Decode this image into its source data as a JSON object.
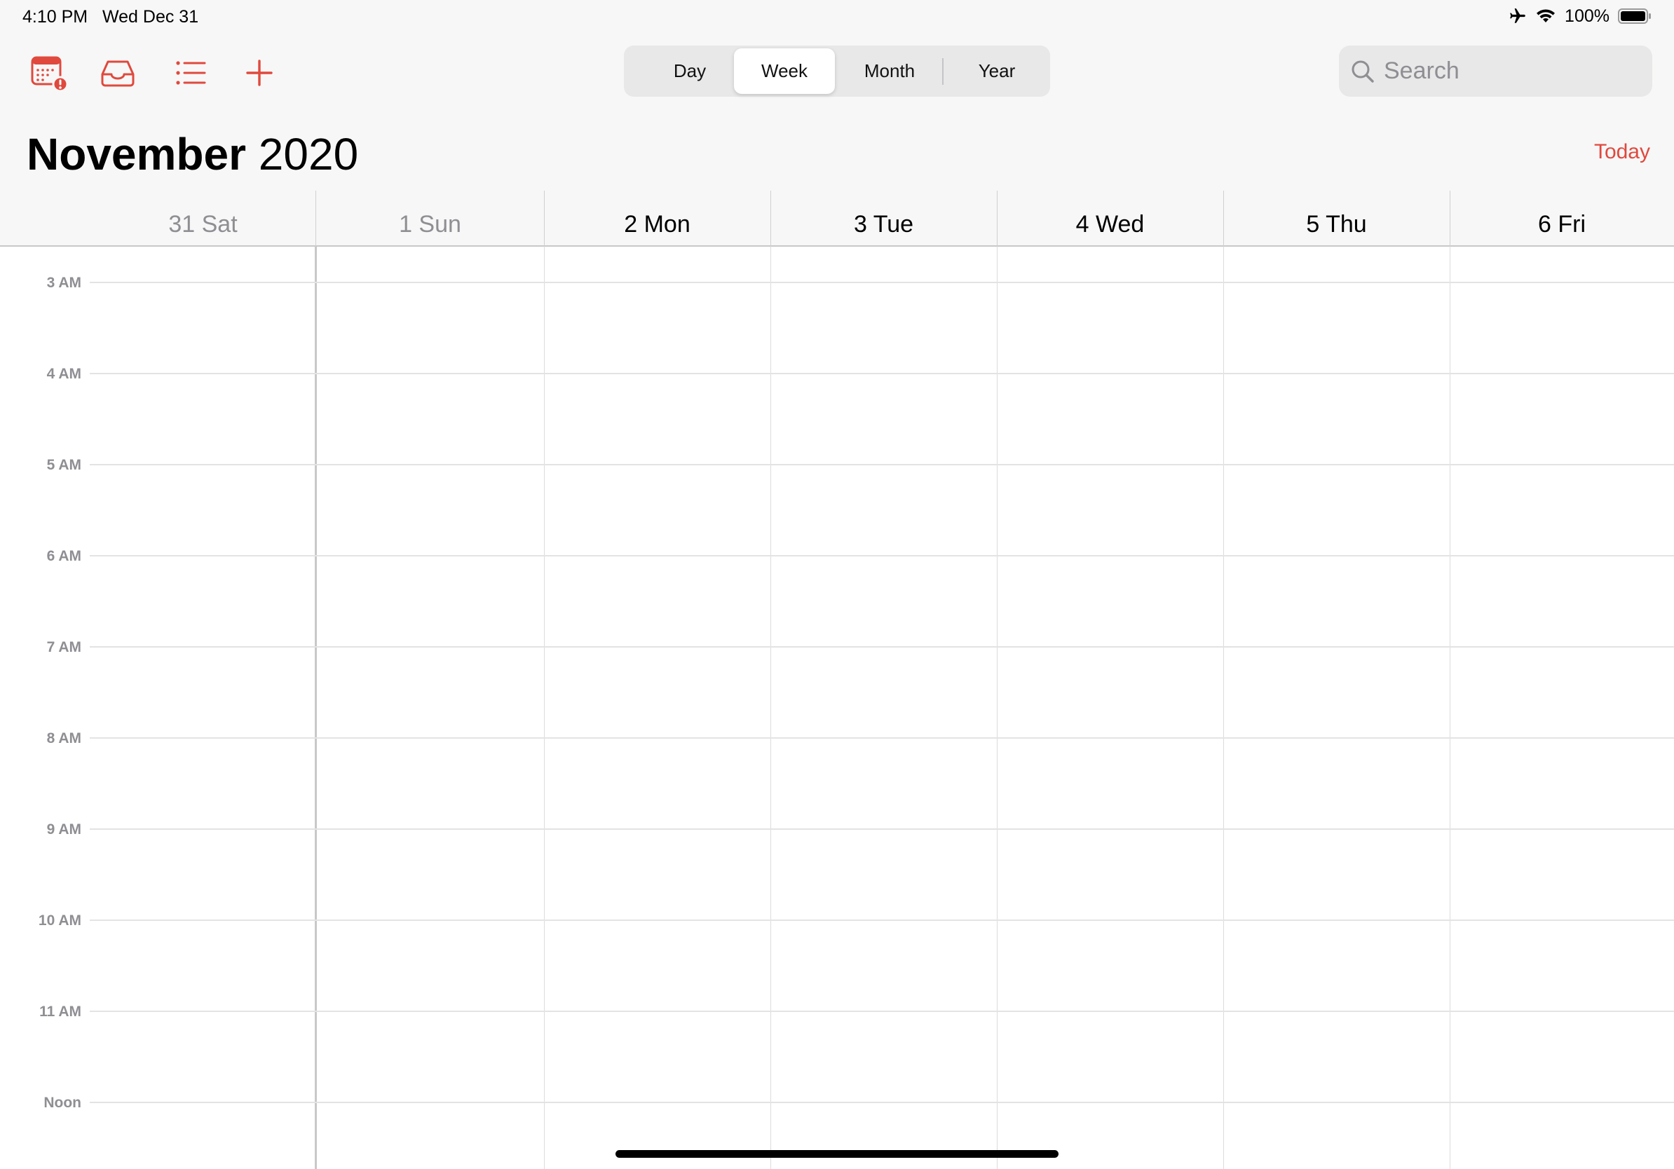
{
  "status_bar": {
    "time": "4:10 PM",
    "date": "Wed Dec 31",
    "battery": "100%",
    "icons": [
      "airplane-icon",
      "wifi-icon",
      "battery-icon"
    ]
  },
  "toolbar": {
    "icons": [
      "calendars-alert-icon",
      "inbox-icon",
      "list-icon",
      "add-icon"
    ],
    "accent_color": "#e0493d"
  },
  "view_switcher": {
    "options": [
      "Day",
      "Week",
      "Month",
      "Year"
    ],
    "selected": "Week"
  },
  "search": {
    "placeholder": "Search",
    "value": ""
  },
  "title": {
    "month": "November",
    "year": "2020"
  },
  "today_label": "Today",
  "days": [
    {
      "label": "31 Sat",
      "past": true
    },
    {
      "label": "1 Sun",
      "past": true
    },
    {
      "label": "2 Mon",
      "past": false
    },
    {
      "label": "3 Tue",
      "past": false
    },
    {
      "label": "4 Wed",
      "past": false
    },
    {
      "label": "5 Thu",
      "past": false
    },
    {
      "label": "6 Fri",
      "past": false
    }
  ],
  "hours": [
    "3 AM",
    "4 AM",
    "5 AM",
    "6 AM",
    "7 AM",
    "8 AM",
    "9 AM",
    "10 AM",
    "11 AM",
    "Noon"
  ]
}
